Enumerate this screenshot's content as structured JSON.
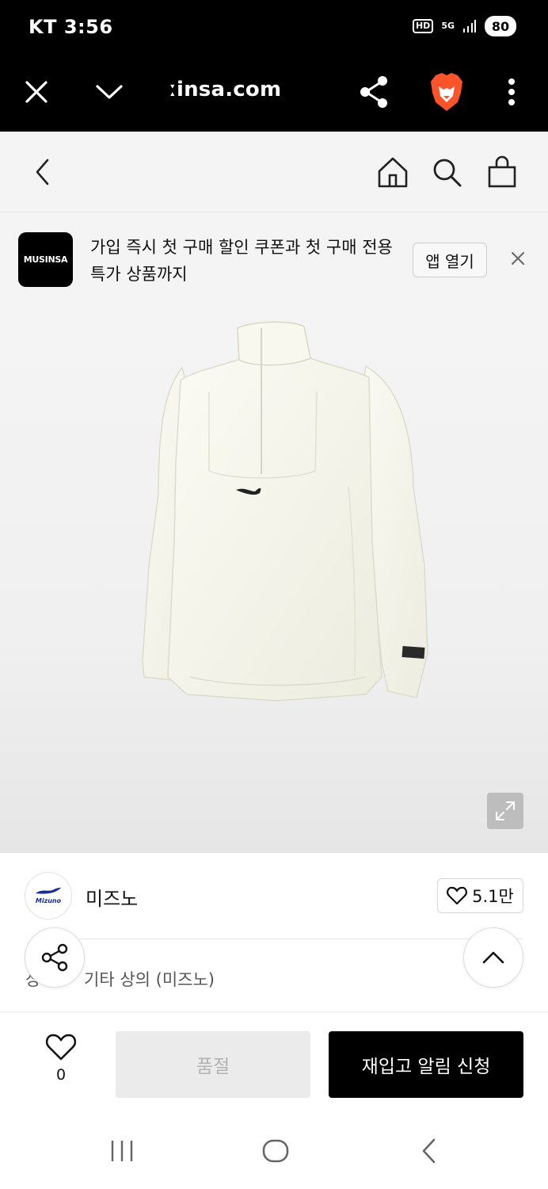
{
  "status_bar": {
    "carrier_time": "KT 3:56",
    "hd_label": "HD",
    "network_label": "5G",
    "battery": "80"
  },
  "browser": {
    "url": "ːinsa.com",
    "icons": [
      "close-icon",
      "chevron-down-icon",
      "share-icon",
      "brave-lion-icon",
      "more-vertical-icon"
    ],
    "brave_color": "#fb542b"
  },
  "site_header": {
    "icons": [
      "back-icon",
      "home-icon",
      "search-icon",
      "bag-icon"
    ]
  },
  "app_banner": {
    "logo_text": "MUSINSA",
    "message": "가입 즉시 첫 구매 할인 쿠폰과 첫 구매 전용 특가 상품까지",
    "open_app_label": "앱 열기"
  },
  "product": {
    "image_subject": "white half-zip pullover jacket",
    "expand_icon": "expand-icon"
  },
  "brand": {
    "logo_text": "Mizuno",
    "name": "미즈노",
    "like_count": "5.1만"
  },
  "category": {
    "prefix": "상",
    "text": "기타 상의 (미즈노)"
  },
  "action_bar": {
    "wish_count": "0",
    "soldout_label": "품절",
    "restock_label": "재입고 알림 신청"
  },
  "system_nav": {
    "icons": [
      "recent-apps-icon",
      "home-circle-icon",
      "back-nav-icon"
    ]
  }
}
